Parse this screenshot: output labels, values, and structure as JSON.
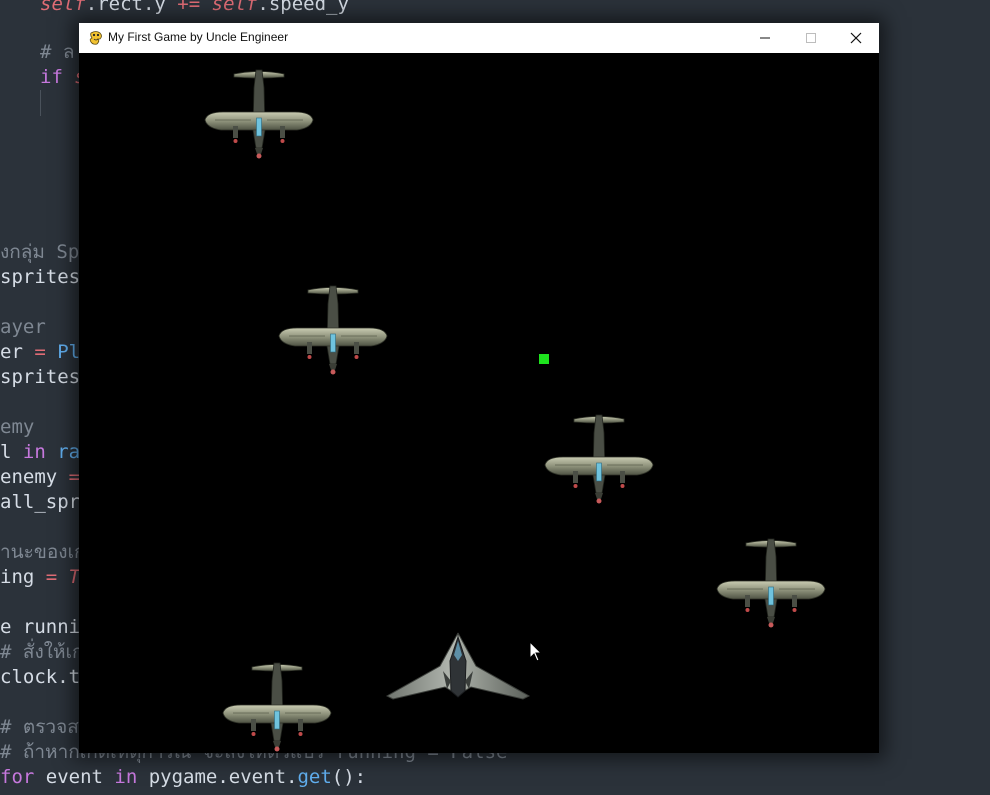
{
  "window": {
    "title": "My First Game by Uncle Engineer",
    "icon": "pygame-snake-icon",
    "controls": [
      "minimize",
      "maximize",
      "close"
    ]
  },
  "editor": {
    "lines": [
      {
        "segments": [
          {
            "t": "self",
            "c": "self"
          },
          {
            "t": ".rect.y ",
            "c": ""
          },
          {
            "t": "+=",
            "c": "op"
          },
          {
            "t": " ",
            "c": ""
          },
          {
            "t": "self",
            "c": "self"
          },
          {
            "t": ".speed_y",
            "c": ""
          }
        ]
      },
      {
        "segments": [
          {
            "t": "# ล",
            "c": "cm"
          }
        ]
      },
      {
        "segments": [
          {
            "t": "if ",
            "c": "kw"
          },
          {
            "t": "s",
            "c": "self"
          }
        ]
      },
      {
        "segments": [
          {
            "t": "งกลุ่ม Sp",
            "c": "cm"
          }
        ]
      },
      {
        "segments": [
          {
            "t": "sprites",
            "c": ""
          }
        ]
      },
      {
        "segments": [
          {
            "t": "ayer",
            "c": "cm"
          }
        ]
      },
      {
        "segments": [
          {
            "t": "er ",
            "c": ""
          },
          {
            "t": "=",
            "c": "op"
          },
          {
            "t": " Pla",
            "c": "fn"
          }
        ]
      },
      {
        "segments": [
          {
            "t": "sprites",
            "c": ""
          }
        ]
      },
      {
        "segments": [
          {
            "t": "emy",
            "c": "cm"
          }
        ]
      },
      {
        "segments": [
          {
            "t": "l ",
            "c": ""
          },
          {
            "t": "in",
            "c": "kw"
          },
          {
            "t": " ran",
            "c": "fn"
          }
        ]
      },
      {
        "segments": [
          {
            "t": "enemy ",
            "c": ""
          },
          {
            "t": "=",
            "c": "op"
          }
        ]
      },
      {
        "segments": [
          {
            "t": "all_spri",
            "c": ""
          }
        ]
      },
      {
        "segments": [
          {
            "t": "านะของเกม",
            "c": "cm"
          }
        ]
      },
      {
        "segments": [
          {
            "t": "ing ",
            "c": ""
          },
          {
            "t": "=",
            "c": "op"
          },
          {
            "t": " Tr",
            "c": "it"
          }
        ]
      },
      {
        "segments": [
          {
            "t": "e runnin",
            "c": ""
          }
        ]
      },
      {
        "segments": [
          {
            "t": "# สั่งให้เกม",
            "c": "cm"
          }
        ]
      },
      {
        "segments": [
          {
            "t": "clock.ti",
            "c": ""
          }
        ]
      },
      {
        "segments": [
          {
            "t": "# ตรวจสอ",
            "c": "cm"
          }
        ]
      },
      {
        "segments": [
          {
            "t": "# ถ้าหากเกิดเหตุการณ์ จะสั่งให้ตัวแปร running = False",
            "c": "cm"
          }
        ]
      },
      {
        "segments": [
          {
            "t": "for",
            "c": "kw"
          },
          {
            "t": " event ",
            "c": ""
          },
          {
            "t": "in",
            "c": "kw"
          },
          {
            "t": " pygame.event.",
            "c": ""
          },
          {
            "t": "get",
            "c": "fn"
          },
          {
            "t": "():",
            "c": ""
          }
        ]
      }
    ]
  },
  "game": {
    "background": "#000000",
    "bullet_color": "#1ee31e",
    "sprites": [
      {
        "kind": "enemy-plane"
      },
      {
        "kind": "enemy-plane"
      },
      {
        "kind": "enemy-plane"
      },
      {
        "kind": "enemy-plane"
      },
      {
        "kind": "enemy-plane"
      },
      {
        "kind": "player-jet"
      },
      {
        "kind": "bullet"
      }
    ]
  }
}
